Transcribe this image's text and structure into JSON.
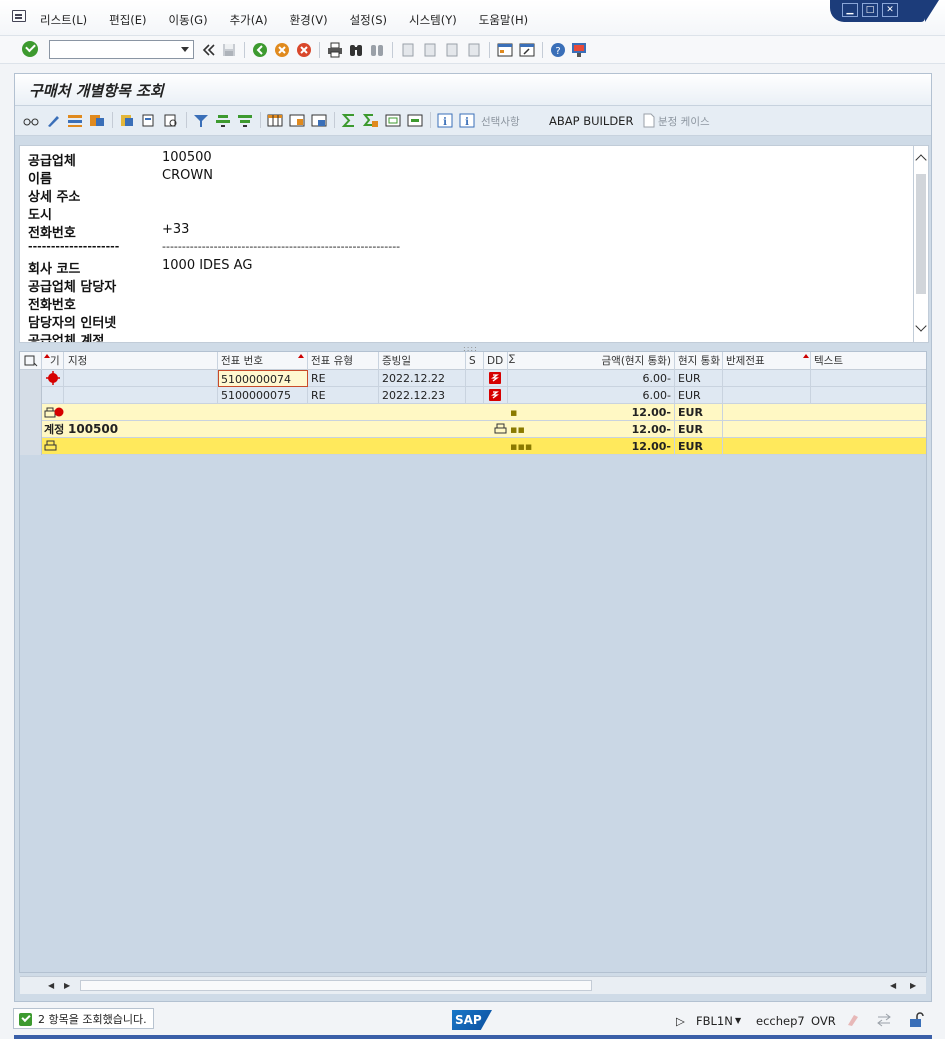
{
  "menubar": {
    "items": [
      "리스트(L)",
      "편집(E)",
      "이동(G)",
      "추가(A)",
      "환경(V)",
      "설정(S)",
      "시스템(Y)",
      "도움말(H)"
    ]
  },
  "toolbar": {
    "command_value": ""
  },
  "screen": {
    "title": "구매처 개별항목 조회"
  },
  "app_toolbar": {
    "selections_label": "선택사항",
    "abap_builder_label": "ABAP BUILDER",
    "split_case_label": "분정 케이스"
  },
  "header": {
    "rows": [
      {
        "label": "공급업체",
        "value": "100500"
      },
      {
        "label": "이름",
        "value": "CROWN"
      },
      {
        "label": "상세 주소",
        "value": ""
      },
      {
        "label": "도시",
        "value": ""
      },
      {
        "label": "전화번호",
        "value": "+33"
      },
      {
        "label": "--------------------",
        "value": "------------------------------------------------------------"
      },
      {
        "label": "회사 코드",
        "value": "1000 IDES AG"
      },
      {
        "label": "공급업체 담당자",
        "value": ""
      },
      {
        "label": "전화번호",
        "value": ""
      },
      {
        "label": "담당자의 인터넷",
        "value": ""
      },
      {
        "label": "공급업체 계정",
        "value": ""
      }
    ]
  },
  "grid": {
    "columns": [
      "기",
      "지정",
      "전표 번호",
      "전표 유형",
      "증빙일",
      "S",
      "DD",
      "금액(현지 통화)",
      "현지 통화",
      "반제전표",
      "텍스트"
    ],
    "rows": [
      {
        "doc_no": "5100000074",
        "doc_type": "RE",
        "doc_date": "2022.12.22",
        "amount": "6.00-",
        "currency": "EUR"
      },
      {
        "doc_no": "5100000075",
        "doc_type": "RE",
        "doc_date": "2022.12.23",
        "amount": "6.00-",
        "currency": "EUR"
      }
    ],
    "subtotal": {
      "amount": "12.00-",
      "currency": "EUR"
    },
    "account_total": {
      "label": "계정",
      "account": "100500",
      "amount": "12.00-",
      "currency": "EUR"
    },
    "grand_total": {
      "amount": "12.00-",
      "currency": "EUR"
    }
  },
  "status": {
    "message": "2 항목을 조회했습니다.",
    "sap_logo": "SAP",
    "transaction": "FBL1N",
    "server": "ecchep7",
    "mode": "OVR"
  },
  "colors": {
    "open_item_red": "#d60000",
    "subtotal_yellow": "#fff8c4",
    "total_yellow": "#ffe95c",
    "ok_green": "#3d9a2f"
  }
}
